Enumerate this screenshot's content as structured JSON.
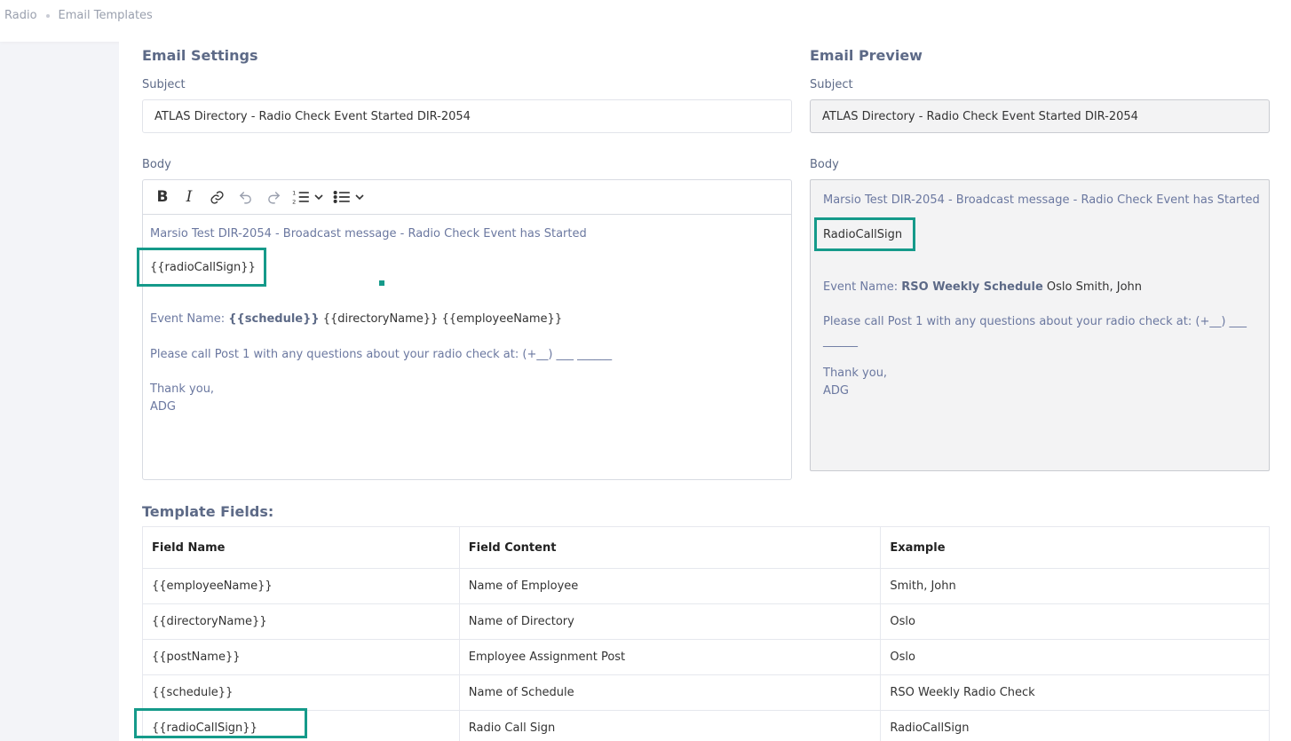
{
  "breadcrumb": {
    "root": "Radio",
    "current": "Email Templates"
  },
  "settings": {
    "title": "Email Settings",
    "subject_label": "Subject",
    "subject_value": "ATLAS Directory - Radio Check Event Started DIR-2054",
    "body_label": "Body",
    "body": {
      "line1": "Marsio Test DIR-2054 - Broadcast message - Radio Check Event has Started",
      "line2": "{{radioCallSign}}",
      "event_prefix": "Event Name: ",
      "event_schedule": "{{schedule}}",
      "event_rest": " {{directoryName}} {{employeeName}}",
      "call_line": "Please call Post 1 with any questions about your radio check at: (+__) ___ ______",
      "thanks": "Thank you,",
      "signature": "ADG"
    }
  },
  "preview": {
    "title": "Email Preview",
    "subject_label": "Subject",
    "subject_value": "ATLAS Directory - Radio Check Event Started DIR-2054",
    "body_label": "Body",
    "body": {
      "line1": "Marsio Test DIR-2054 - Broadcast message - Radio Check Event has Started",
      "line2": "RadioCallSign",
      "event_prefix": "Event Name: ",
      "event_schedule": "RSO Weekly Schedule",
      "event_rest": " Oslo Smith, John",
      "call_line1": "Please call Post 1 with any questions about your radio check at: (+__) ___",
      "call_line2": "______",
      "thanks": "Thank you,",
      "signature": "ADG"
    }
  },
  "template_fields": {
    "title": "Template Fields:",
    "headers": [
      "Field Name",
      "Field Content",
      "Example"
    ],
    "rows": [
      [
        "{{employeeName}}",
        "Name of Employee",
        "Smith, John"
      ],
      [
        "{{directoryName}}",
        "Name of Directory",
        "Oslo"
      ],
      [
        "{{postName}}",
        "Employee Assignment Post",
        "Oslo"
      ],
      [
        "{{schedule}}",
        "Name of Schedule",
        "RSO Weekly Radio Check"
      ],
      [
        "{{radioCallSign}}",
        "Radio Call Sign",
        "RadioCallSign"
      ]
    ]
  },
  "icons": [
    "bold-icon",
    "italic-icon",
    "link-icon",
    "undo-icon",
    "redo-icon",
    "ordered-list-icon",
    "chevron-down-icon",
    "bullet-list-icon"
  ],
  "colors": {
    "highlight": "#159a8a",
    "heading": "#5d6a87",
    "body_text": "#6b78a0"
  }
}
